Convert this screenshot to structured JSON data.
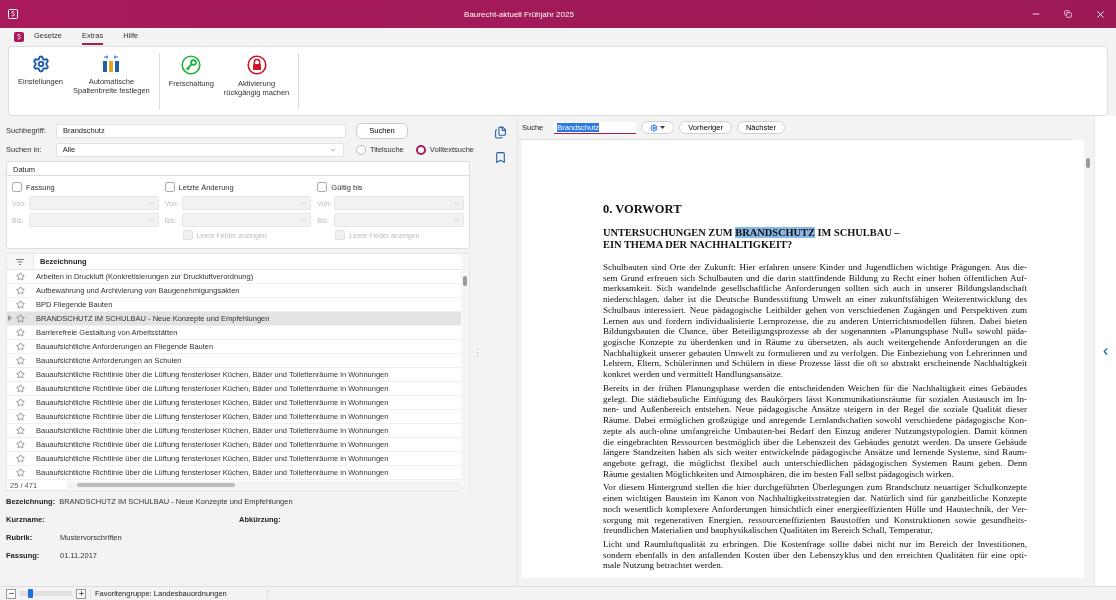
{
  "window": {
    "title": "Baurecht-aktuell Frühjahr 2025"
  },
  "menu": [
    {
      "label": "Gesetze",
      "selected": false
    },
    {
      "label": "Extras",
      "selected": true
    },
    {
      "label": "Hilfe",
      "selected": false
    }
  ],
  "ribbon": {
    "groups": [
      {
        "buttons": [
          {
            "kind": "gear",
            "lines": [
              "Einstellungen"
            ]
          },
          {
            "kind": "columns",
            "lines": [
              "Automatische",
              "Spaltenbreite festlegen"
            ]
          }
        ]
      },
      {
        "buttons": [
          {
            "kind": "key",
            "lines": [
              "Freischaltung"
            ]
          },
          {
            "kind": "lock",
            "lines": [
              "Aktivierung",
              "rückgängig machen"
            ]
          }
        ]
      }
    ]
  },
  "search": {
    "term_label": "Suchbegriff:",
    "term": "Brandschutz",
    "button": "Suchen",
    "scope_label": "Suchen in:",
    "scope": "Alle",
    "modes": [
      {
        "label": "Titelsuche",
        "selected": false
      },
      {
        "label": "Volltextsuche",
        "selected": true
      }
    ]
  },
  "date_filter": {
    "title": "Datum",
    "columns": [
      {
        "label": "Fassung",
        "checked": false,
        "from_label": "Von:",
        "to_label": "Bis:"
      },
      {
        "label": "Letzte Änderung",
        "checked": false,
        "from_label": "Von:",
        "to_label": "Bis:",
        "empty_fields": {
          "label": "Leere Felder anzeigen",
          "checked": false
        }
      },
      {
        "label": "Gültig bis",
        "checked": false,
        "from_label": "Von:",
        "to_label": "Bis:",
        "empty_fields": {
          "label": "Leere Felder anzeigen",
          "checked": false
        }
      }
    ]
  },
  "list": {
    "column": "Bezeichnung",
    "count": "25 / 471",
    "rows": [
      {
        "title": "Arbeiten in Druckluft (Konkretisierungen zur Druckluftverordnung)",
        "selected": false
      },
      {
        "title": "Aufbewahrung und Archivierung von Baugenehmigungsakten",
        "selected": false
      },
      {
        "title": "BPD Fliegende Bauten",
        "selected": false
      },
      {
        "title": "BRANDSCHUTZ IM SCHULBAU - Neue Konzepte und Empfehlungen",
        "selected": true
      },
      {
        "title": "Barrierefreie Gestaltung von Arbeitsstätten",
        "selected": false
      },
      {
        "title": "Bauaufsichtliche Anforderungen an Fliegende Bauten",
        "selected": false
      },
      {
        "title": "Bauaufsichtliche Anforderungen an Schulen",
        "selected": false
      },
      {
        "title": "Bauaufsichtliche Richtlinie über die Lüftung fensterloser Küchen, Bäder und Toilettenräume in Wohnungen",
        "selected": false
      },
      {
        "title": "Bauaufsichtliche Richtlinie über die Lüftung fensterloser Küchen, Bäder und Toilettenräume in Wohnungen",
        "selected": false
      },
      {
        "title": "Bauaufsichtliche Richtlinie über die Lüftung fensterloser Küchen, Bäder und Toilettenräume in Wohnungen",
        "selected": false
      },
      {
        "title": "Bauaufsichtliche Richtlinie über die Lüftung fensterloser Küchen, Bäder und Toilettenräume in Wohnungen",
        "selected": false
      },
      {
        "title": "Bauaufsichtliche Richtlinie über die Lüftung fensterloser Küchen, Bäder und Toilettenräume in Wohnungen",
        "selected": false
      },
      {
        "title": "Bauaufsichtliche Richtlinie über die Lüftung fensterloser Küchen, Bäder und Toilettenräume in Wohnungen",
        "selected": false
      },
      {
        "title": "Bauaufsichtliche Richtlinie über die Lüftung fensterloser Küchen, Bäder und Toilettenräume in Wohnungen",
        "selected": false
      },
      {
        "title": "Bauaufsichtliche Richtlinie über die Lüftung fensterloser Küchen, Bäder und Toilettenräume in Wohnungen",
        "selected": false
      }
    ]
  },
  "details": {
    "name": {
      "label": "Bezeichnung:",
      "value": "BRANDSCHUTZ IM SCHULBAU - Neue Konzepte und Empfehlungen"
    },
    "short_name": {
      "label": "Kurzname:"
    },
    "abbreviation": {
      "label": "Abkürzung:"
    },
    "category": {
      "label": "Rubrik:",
      "value": "Mustervorschriften"
    },
    "version": {
      "label": "Fassung:",
      "value": "01.11.2017"
    }
  },
  "viewer": {
    "search_label": "Suche",
    "search_value": "Brandschutz",
    "prev": "Vorheriger",
    "next": "Nächster",
    "document": {
      "heading": "0. VORWORT",
      "subheading": [
        [
          {
            "text": "UNTERSUCHUNGEN ZUM ",
            "highlighted": false
          },
          {
            "text": "BRANDSCHUTZ",
            "highlighted": true
          },
          {
            "text": " IM SCHULBAU –",
            "highlighted": false
          }
        ],
        [
          {
            "text": "EIN THEMA DER NACHHALTIGKEIT?",
            "highlighted": false
          }
        ]
      ],
      "paragraphs": [
        [
          "Schulbauten sind Orte der Zukunft: Hier erfahren unsere Kinder und Jugendlichen wichtige Prägungen. Aus die-",
          "sem Grund erfreuen sich Schulbauten und die darin stattfindende Bildung zu Recht einer hohen öffentlichen Auf-",
          "merksamkeit. Sich wandelnde gesellschaftliche Anforderungen sollten sich auch in unserer Bildungslandschaft",
          "niederschlagen, daher ist die Deutsche Bundesstiftung Umwelt an einer zukunftsfähigen Weiterentwicklung des",
          "Schulbaus interessiert. Neue pädagogische Leitbilder gehen von verschiedenen Zugängen und Perspektiven zum",
          "Lernen aus und fordern individualisierte Lernprozesse, die zu anderen Unterrichtsmodellen führen. Dabei bieten",
          "Bildungsbauten die Chance, über Beteiligungsprozesse ab der sogenannten »Planungsphase Null« sowohl päda-",
          "gogische Konzepte zu überdenken und in Räume zu übersetzen, als auch weitergehende Anforderungen an die",
          "Nachhaltigkeit unserer gebauten Umwelt zu formulieren und zu verfolgen. Die Einbeziehung von Lehrerinnen und",
          "Lehrern, Eltern, Schülerinnen und Schülern in diese Prozesse lässt die oft so abstrakt erscheinende Nachhaltigkeit",
          "konkret werden und vermittelt Handlungsansätze."
        ],
        [
          "Bereits in der frühen Planungsphase werden die entscheidenden Weichen für die Nachhaltigkeit eines Gebäudes",
          "gelegt. Die städtebauliche Einfügung des Baukörpers lässt Kommunikationsräume für sozialen Austausch im In-",
          "nen- und Außenbereich entstehen. Neue pädagogische Ansätze steigern in der Regel die soziale Qualität dieser",
          "Räume. Dabei ermöglichen großzügige und anregende Lernlandschaften sowohl verschiedene pädagogische Kon-",
          "zepte als auch-ohne umfangreiche Umbauten-bei Bedarf den Einzug anderer Nutzungstypologien. Damit können",
          "die eingebrachten Ressourcen bestmöglich über die Lebenszeit des Gebäudes genutzt werden. Da unsere Gebäude",
          "längere Standzeiten haben als sich weiter entwickelnde pädagogische Ansätze und lernende Systeme, sind Raum-",
          "angebote gefragt, die möglichst flexibel auch unterschiedlichen pädagogischen Systemen Raum geben. Denn",
          "Räume gestalten Möglichkeiten und Atmosphären, die im besten Fall selbst pädagogisch wirken."
        ],
        [
          "Vor diesem Hintergrund stellen die hier durchgeführten Überlegungen zum Brandschutz neuartiger Schulkonzepte",
          "einen wichtigen Baustein im Kanon von Nachhaltigkeitsstrategien dar. Natürlich sind für ganzheitliche Konzepte",
          "noch wesentlich komplexere Anforderungen hinsichtlich einer energieeffizienten Hülle und Haustechnik, der Ver-",
          "sorgung mit regenerativen Energien, ressourceneffizienten Baustoffen und Konstruktionen sowie gesundheits-",
          "freundlichen Materialien und bauphysikalischen Qualitäten im Bereich Schall, Temperatur,"
        ],
        [
          "Licht und Raumluftqualität zu erbringen. Die Kostenfrage sollte dabei nicht nur im Bereich der Investitionen,",
          "sondern ebenfalls in den anfallenden Kosten über den Lebenszyklus und den erreichten Qualitäten für eine opti-",
          "male Nutzung betrachtet werden."
        ]
      ]
    }
  },
  "status": {
    "zoom": {
      "level": 0.2
    },
    "favorites": "Favoritengruppe: Landesbauordnungen"
  }
}
